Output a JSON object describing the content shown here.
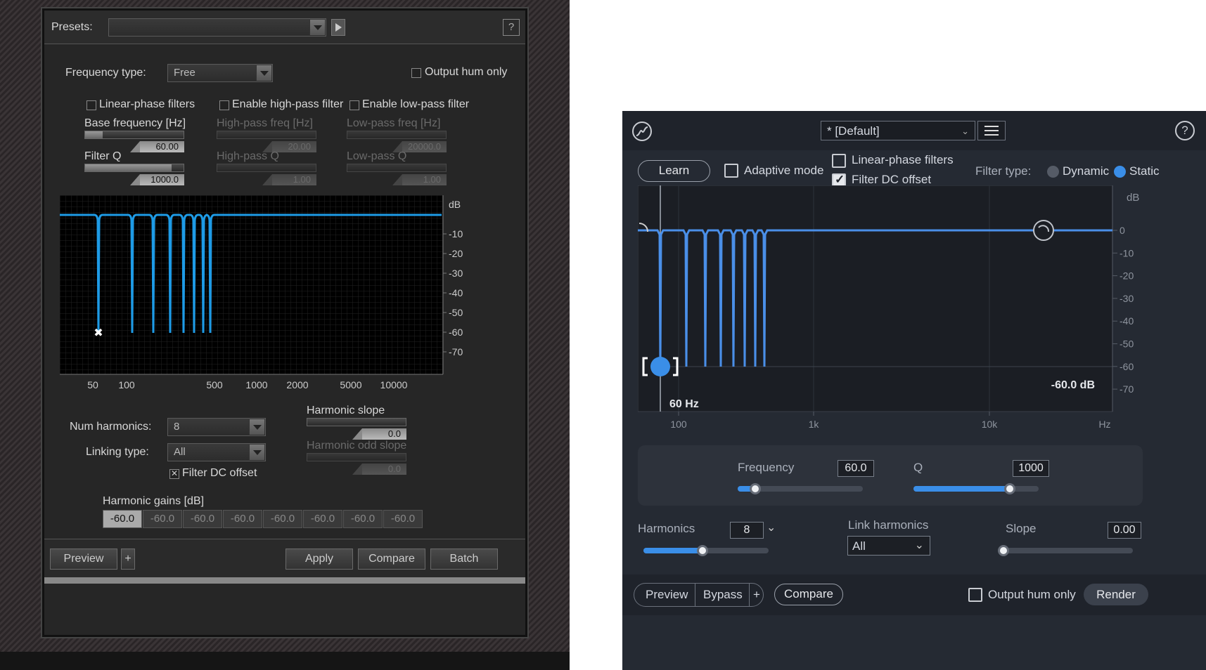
{
  "old": {
    "presets_label": "Presets:",
    "help": "?",
    "frequency_type_label": "Frequency type:",
    "frequency_type_value": "Free",
    "output_hum_only": "Output hum only",
    "linear_phase": "Linear-phase filters",
    "enable_highpass": "Enable high-pass filter",
    "enable_lowpass": "Enable low-pass filter",
    "base_freq_label": "Base frequency [Hz]",
    "base_freq_value": "60.00",
    "base_freq_fraction": 0.18,
    "filter_q_label": "Filter Q",
    "filter_q_value": "1000.0",
    "filter_q_fraction": 0.88,
    "highpass_freq_label": "High-pass freq [Hz]",
    "highpass_freq_value": "20.00",
    "highpass_q_label": "High-pass Q",
    "highpass_q_value": "1.00",
    "lowpass_freq_label": "Low-pass freq [Hz]",
    "lowpass_freq_value": "20000.0",
    "lowpass_q_label": "Low-pass Q",
    "lowpass_q_value": "1.00",
    "graph": {
      "db_label": "dB",
      "db_ticks": [
        "-10",
        "-20",
        "-30",
        "-40",
        "-50",
        "-60",
        "-70"
      ],
      "freq_ticks": [
        "50",
        "100",
        "500",
        "1000",
        "2000",
        "5000",
        "10000"
      ]
    },
    "num_harmonics_label": "Num harmonics:",
    "num_harmonics_value": "8",
    "linking_type_label": "Linking type:",
    "linking_type_value": "All",
    "filter_dc_offset": "Filter DC offset",
    "harmonic_slope_label": "Harmonic slope",
    "harmonic_slope_value": "0.0",
    "harmonic_odd_slope_label": "Harmonic odd slope",
    "harmonic_odd_slope_value": "0.0",
    "harmonic_gains_label": "Harmonic gains [dB]",
    "harmonic_gains": [
      "-60.0",
      "-60.0",
      "-60.0",
      "-60.0",
      "-60.0",
      "-60.0",
      "-60.0",
      "-60.0"
    ],
    "preview": "Preview",
    "plus": "+",
    "apply": "Apply",
    "compare": "Compare",
    "batch": "Batch"
  },
  "new": {
    "preset": "* [Default]",
    "help": "?",
    "learn": "Learn",
    "adaptive_mode": "Adaptive mode",
    "linear_phase": "Linear-phase filters",
    "filter_dc_offset": "Filter DC offset",
    "filter_type_label": "Filter type:",
    "dynamic": "Dynamic",
    "static": "Static",
    "graph": {
      "db_label": "dB",
      "db_ticks": [
        "0",
        "-10",
        "-20",
        "-30",
        "-40",
        "-50",
        "-60",
        "-70"
      ],
      "freq_ticks": [
        "100",
        "1k",
        "10k",
        "Hz"
      ],
      "node_freq": "60 Hz",
      "node_gain": "-60.0 dB"
    },
    "frequency_label": "Frequency",
    "frequency_value": "60.0",
    "frequency_fraction": 0.14,
    "q_label": "Q",
    "q_value": "1000",
    "q_fraction": 0.77,
    "harmonics_label": "Harmonics",
    "harmonics_value": "8",
    "harmonics_fraction": 0.47,
    "link_harmonics_label": "Link harmonics",
    "link_harmonics_value": "All",
    "slope_label": "Slope",
    "slope_value": "0.00",
    "slope_fraction": 0.0,
    "preview": "Preview",
    "bypass": "Bypass",
    "plus": "+",
    "compare": "Compare",
    "output_hum_only": "Output hum only",
    "render": "Render"
  },
  "colors": {
    "curve_old": "#1e9be6",
    "curve_new": "#4a8fe8",
    "accent": "#3a8ee8"
  }
}
